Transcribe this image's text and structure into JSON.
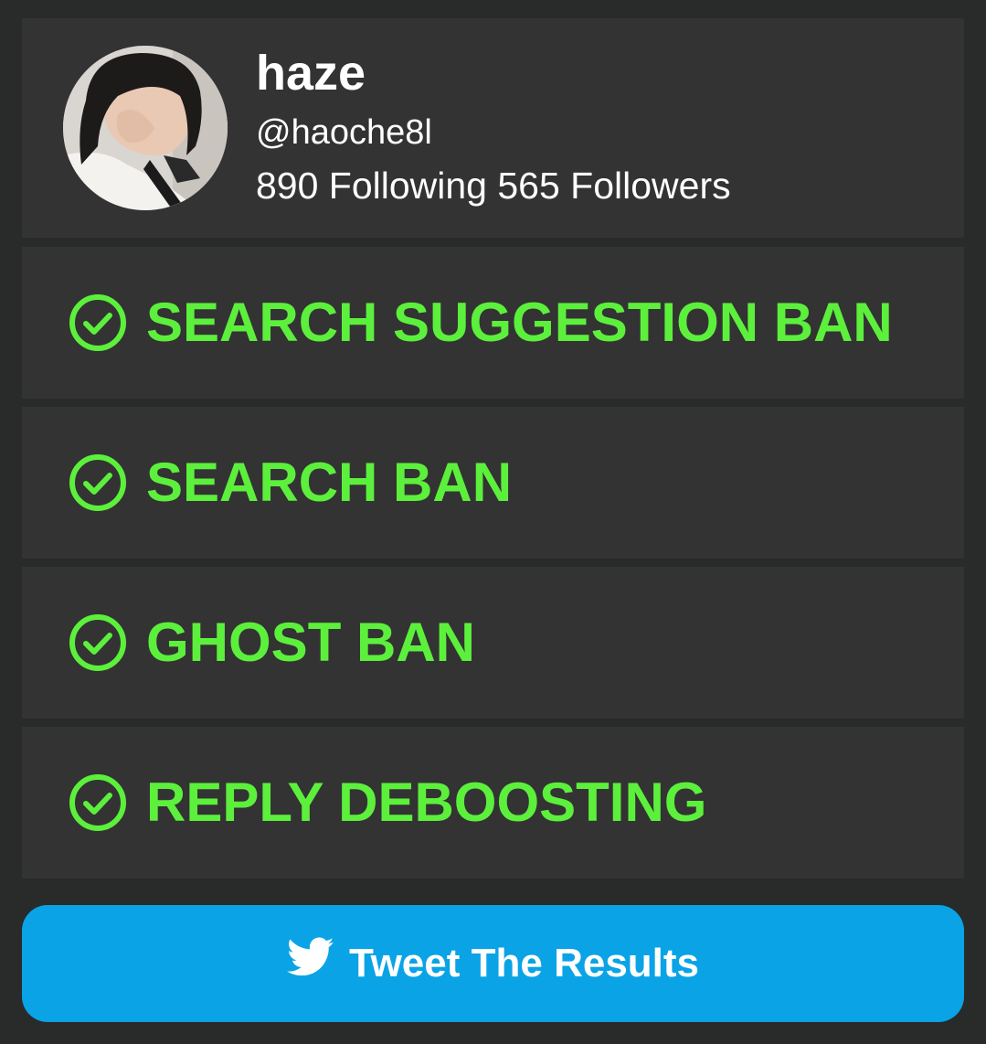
{
  "profile": {
    "name": "haze",
    "handle": "@haoche8l",
    "stats": "890 Following 565 Followers"
  },
  "checks": [
    {
      "label": "SEARCH SUGGESTION BAN",
      "icon": "check-circle-icon",
      "status": "passed"
    },
    {
      "label": "SEARCH BAN",
      "icon": "check-circle-icon",
      "status": "passed"
    },
    {
      "label": "GHOST BAN",
      "icon": "check-circle-icon",
      "status": "passed"
    },
    {
      "label": "REPLY DEBOOSTING",
      "icon": "check-circle-icon",
      "status": "passed"
    }
  ],
  "tweet_button": {
    "label": "Tweet The Results",
    "icon": "twitter-bird-icon"
  },
  "colors": {
    "background": "#292a2a",
    "card": "#333333",
    "pass_green": "#5cf03c",
    "tweet_blue": "#0aa3e6",
    "text": "#ffffff"
  }
}
